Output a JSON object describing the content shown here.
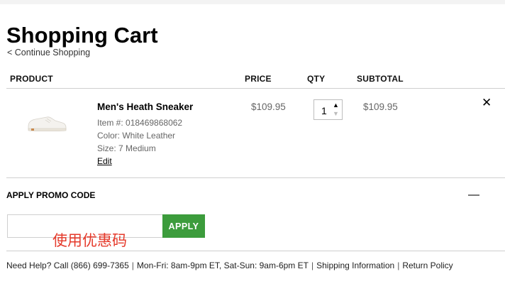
{
  "page": {
    "title": "Shopping Cart",
    "continue_link": "< Continue Shopping"
  },
  "table_headers": {
    "product": "PRODUCT",
    "price": "PRICE",
    "qty": "QTY",
    "subtotal": "SUBTOTAL"
  },
  "item": {
    "name": "Men's Heath Sneaker",
    "item_no": "Item #: 018469868062",
    "color": "Color: White Leather",
    "size": "Size: 7 Medium",
    "edit_label": "Edit",
    "price": "$109.95",
    "quantity": "1",
    "subtotal": "$109.95",
    "remove_icon": "close-icon",
    "thumbnail": "sneaker-image"
  },
  "promo": {
    "title": "APPLY PROMO CODE",
    "collapse_icon": "minus-icon",
    "input_value": "",
    "placeholder": "",
    "apply_label": "APPLY",
    "annotation": "使用优惠码"
  },
  "footer": {
    "help_text": "Need Help? Call (866) 699-7365",
    "hours": "Mon-Fri: 8am-9pm ET, Sat-Sun: 9am-6pm ET",
    "shipping_link": "Shipping Information",
    "return_link": "Return Policy"
  },
  "colors": {
    "apply_button": "#3c9c3c",
    "annotation": "#e5392a"
  }
}
